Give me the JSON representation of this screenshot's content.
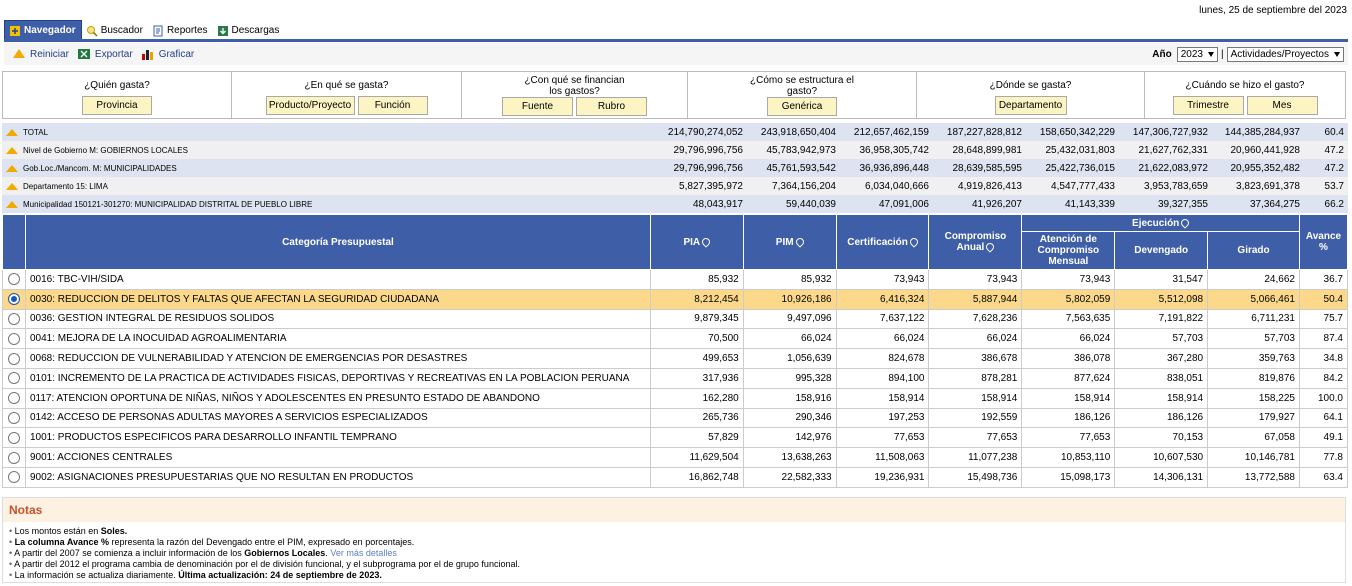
{
  "date": "lunes, 25 de septiembre del 2023",
  "tabs": [
    {
      "label": "Navegador",
      "icon": "navigator-icon",
      "active": true
    },
    {
      "label": "Buscador",
      "icon": "search-icon",
      "active": false
    },
    {
      "label": "Reportes",
      "icon": "report-icon",
      "active": false
    },
    {
      "label": "Descargas",
      "icon": "download-icon",
      "active": false
    }
  ],
  "toolbar": {
    "reset_label": "Reiniciar",
    "export_label": "Exportar",
    "chart_label": "Graficar",
    "year_label": "Año",
    "year_value": "2023",
    "view_value": "Actividades/Proyectos"
  },
  "questions": [
    {
      "title": "¿Quién gasta?",
      "buttons": [
        "Provincia"
      ]
    },
    {
      "title": "¿En qué se gasta?",
      "buttons": [
        "Producto/Proyecto",
        "Función"
      ]
    },
    {
      "title": "¿Con qué se financian los gastos?",
      "buttons": [
        "Fuente",
        "Rubro"
      ]
    },
    {
      "title": "¿Cómo se estructura el gasto?",
      "buttons": [
        "Genérica"
      ]
    },
    {
      "title": "¿Dónde se gasta?",
      "buttons": [
        "Departamento"
      ]
    },
    {
      "title": "¿Cuándo se hizo el gasto?",
      "buttons": [
        "Trimestre",
        "Mes"
      ]
    }
  ],
  "summary_rows": [
    {
      "label": "TOTAL",
      "values": [
        "214,790,274,052",
        "243,918,650,404",
        "212,657,462,159",
        "187,227,828,812",
        "158,650,342,229",
        "147,306,727,932",
        "144,385,284,937",
        "60.4"
      ]
    },
    {
      "label": "Nivel de Gobierno M: GOBIERNOS LOCALES",
      "values": [
        "29,796,996,756",
        "45,783,942,973",
        "36,958,305,742",
        "28,648,899,981",
        "25,432,031,803",
        "21,627,762,331",
        "20,960,441,928",
        "47.2"
      ]
    },
    {
      "label": "Gob.Loc./Mancom. M: MUNICIPALIDADES",
      "values": [
        "29,796,996,756",
        "45,761,593,542",
        "36,936,896,448",
        "28,639,585,595",
        "25,422,736,015",
        "21,622,083,972",
        "20,955,352,482",
        "47.2"
      ]
    },
    {
      "label": "Departamento 15: LIMA",
      "values": [
        "5,827,395,972",
        "7,364,156,204",
        "6,034,040,666",
        "4,919,826,413",
        "4,547,777,433",
        "3,953,783,659",
        "3,823,691,378",
        "53.7"
      ]
    },
    {
      "label": "Municipalidad 150121-301270: MUNICIPALIDAD DISTRITAL DE PUEBLO LIBRE",
      "values": [
        "48,043,917",
        "59,440,039",
        "47,091,006",
        "41,926,207",
        "41,143,339",
        "39,327,355",
        "37,364,275",
        "66.2"
      ]
    }
  ],
  "table": {
    "headers": {
      "category": "Categoría Presupuestal",
      "pia": "PIA",
      "pim": "PIM",
      "cert": "Certificación",
      "comp": "Compromiso Anual",
      "ejecucion": "Ejecución",
      "acm": "Atención de Compromiso Mensual",
      "dev": "Devengado",
      "gir": "Girado",
      "avance": "Avance %"
    },
    "rows": [
      {
        "name": "0016: TBC-VIH/SIDA",
        "values": [
          "85,932",
          "85,932",
          "73,943",
          "73,943",
          "73,943",
          "31,547",
          "24,662",
          "36.7"
        ],
        "selected": false
      },
      {
        "name": "0030: REDUCCION DE DELITOS Y FALTAS QUE AFECTAN LA SEGURIDAD CIUDADANA",
        "values": [
          "8,212,454",
          "10,926,186",
          "6,416,324",
          "5,887,944",
          "5,802,059",
          "5,512,098",
          "5,066,461",
          "50.4"
        ],
        "selected": true
      },
      {
        "name": "0036: GESTION INTEGRAL DE RESIDUOS SOLIDOS",
        "values": [
          "9,879,345",
          "9,497,096",
          "7,637,122",
          "7,628,236",
          "7,563,635",
          "7,191,822",
          "6,711,231",
          "75.7"
        ],
        "selected": false
      },
      {
        "name": "0041: MEJORA DE LA INOCUIDAD AGROALIMENTARIA",
        "values": [
          "70,500",
          "66,024",
          "66,024",
          "66,024",
          "66,024",
          "57,703",
          "57,703",
          "87.4"
        ],
        "selected": false
      },
      {
        "name": "0068: REDUCCION DE VULNERABILIDAD Y ATENCION DE EMERGENCIAS POR DESASTRES",
        "values": [
          "499,653",
          "1,056,639",
          "824,678",
          "386,678",
          "386,078",
          "367,280",
          "359,763",
          "34.8"
        ],
        "selected": false
      },
      {
        "name": "0101: INCREMENTO DE LA PRACTICA DE ACTIVIDADES FISICAS, DEPORTIVAS Y RECREATIVAS EN LA POBLACION PERUANA",
        "values": [
          "317,936",
          "995,328",
          "894,100",
          "878,281",
          "877,624",
          "838,051",
          "819,876",
          "84.2"
        ],
        "selected": false
      },
      {
        "name": "0117: ATENCION OPORTUNA DE NIÑAS, NIÑOS Y ADOLESCENTES EN PRESUNTO ESTADO DE ABANDONO",
        "values": [
          "162,280",
          "158,916",
          "158,914",
          "158,914",
          "158,914",
          "158,914",
          "158,225",
          "100.0"
        ],
        "selected": false
      },
      {
        "name": "0142: ACCESO DE PERSONAS ADULTAS MAYORES A SERVICIOS ESPECIALIZADOS",
        "values": [
          "265,736",
          "290,346",
          "197,253",
          "192,559",
          "186,126",
          "186,126",
          "179,927",
          "64.1"
        ],
        "selected": false
      },
      {
        "name": "1001: PRODUCTOS ESPECIFICOS PARA DESARROLLO INFANTIL TEMPRANO",
        "values": [
          "57,829",
          "142,976",
          "77,653",
          "77,653",
          "77,653",
          "70,153",
          "67,058",
          "49.1"
        ],
        "selected": false
      },
      {
        "name": "9001: ACCIONES CENTRALES",
        "values": [
          "11,629,504",
          "13,638,263",
          "11,508,063",
          "11,077,238",
          "10,853,110",
          "10,607,530",
          "10,146,781",
          "77.8"
        ],
        "selected": false
      },
      {
        "name": "9002: ASIGNACIONES PRESUPUESTARIAS QUE NO RESULTAN EN PRODUCTOS",
        "values": [
          "16,862,748",
          "22,582,333",
          "19,236,931",
          "15,498,736",
          "15,098,173",
          "14,306,131",
          "13,772,588",
          "63.4"
        ],
        "selected": false
      }
    ]
  },
  "notes": {
    "title": "Notas",
    "n1_pre": "Los montos están en ",
    "n1_bold": "Soles.",
    "n2_bold": "La columna Avance %",
    "n2_post": " representa la razón del Devengado entre el PIM, expresado en porcentajes.",
    "n3_pre": "A partir del 2007 se comienza a incluir información de los ",
    "n3_bold": "Gobiernos Locales",
    "n3_link": "Ver más detalles",
    "n4": "A partir del 2012 el programa cambia de denominación por el de división funcional, y el subprograma por el de grupo funcional.",
    "n5_pre": "La información se actualiza diariamente. ",
    "n5_bold": "Última actualización: 24 de septiembre de 2023."
  }
}
